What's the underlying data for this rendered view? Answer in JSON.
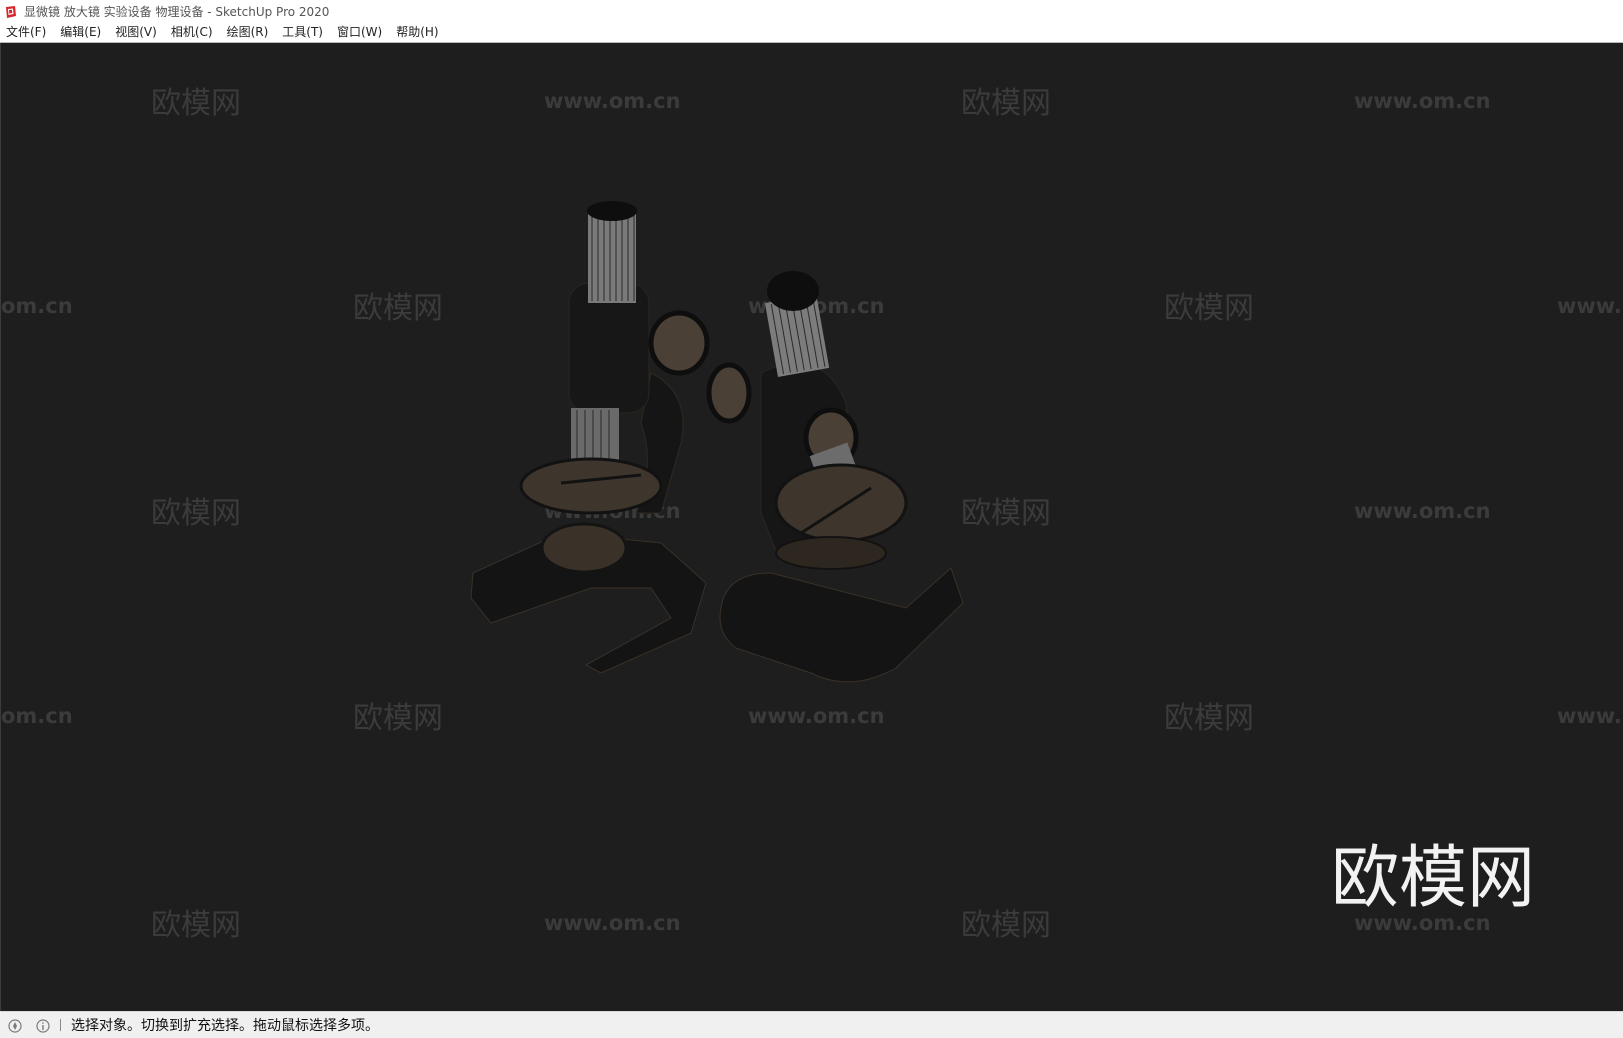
{
  "window": {
    "title": "显微镜 放大镜 实验设备 物理设备 - SketchUp Pro 2020"
  },
  "menu": {
    "items": [
      {
        "label": "文件(F)"
      },
      {
        "label": "编辑(E)"
      },
      {
        "label": "视图(V)"
      },
      {
        "label": "相机(C)"
      },
      {
        "label": "绘图(R)"
      },
      {
        "label": "工具(T)"
      },
      {
        "label": "窗口(W)"
      },
      {
        "label": "帮助(H)"
      }
    ]
  },
  "viewport": {
    "background": "#1e1e1e",
    "watermark_cn": "欧模网",
    "watermark_url": "www.om.cn",
    "watermark_url_left_partial": "om.cn",
    "watermark_url_right_partial": "www.",
    "logo_text": "欧模网",
    "logo_url": "www.om.cn",
    "model_description_icon": "microscope-model"
  },
  "status": {
    "icons": [
      "geo-location-icon",
      "info-icon"
    ],
    "text": "选择对象。切换到扩充选择。拖动鼠标选择多项。"
  }
}
